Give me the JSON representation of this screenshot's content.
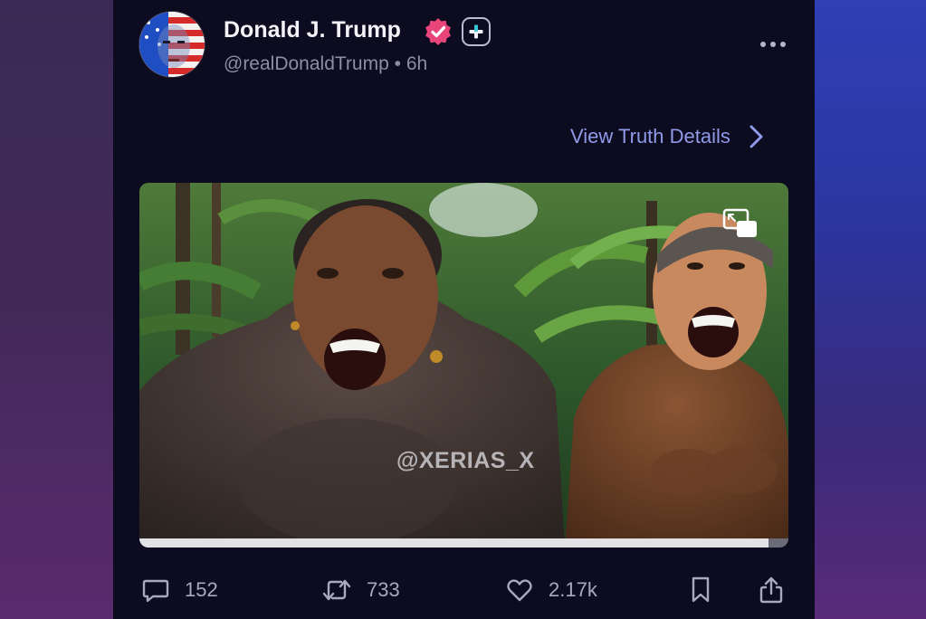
{
  "post": {
    "author_name": "Donald J. Trump",
    "handle": "@realDonaldTrump",
    "separator": "•",
    "time": "6h",
    "view_details_label": "View Truth Details",
    "video": {
      "watermark": "@XERIAS_X",
      "progress": 0.97
    },
    "actions": {
      "replies": "152",
      "retruths": "733",
      "likes": "2.17k"
    }
  },
  "colors": {
    "card_bg": "#0c0b1f",
    "accent_link": "#8f9be8",
    "verified_badge": "#e8457a",
    "muted_text": "#8c8ea8"
  },
  "icons": [
    "verified-icon",
    "plus-icon",
    "more-icon",
    "chevron-right-icon",
    "pip-icon",
    "reply-icon",
    "retruth-icon",
    "heart-icon",
    "bookmark-icon",
    "share-icon"
  ]
}
